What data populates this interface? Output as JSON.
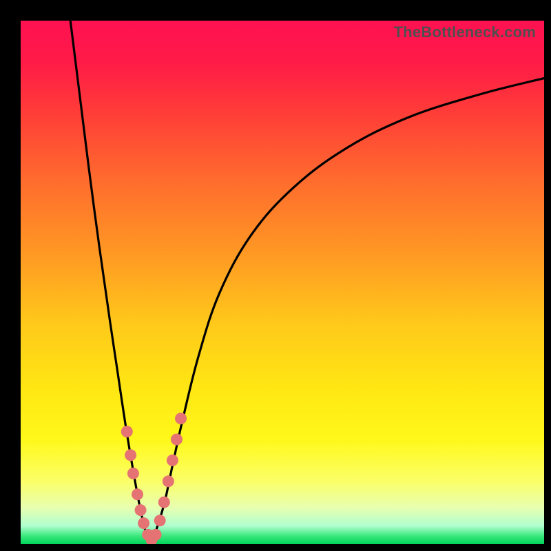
{
  "watermark": "TheBottleneck.com",
  "gradient": {
    "stops": [
      {
        "offset": 0.0,
        "color": "#ff1151"
      },
      {
        "offset": 0.08,
        "color": "#ff1b47"
      },
      {
        "offset": 0.18,
        "color": "#ff3e37"
      },
      {
        "offset": 0.3,
        "color": "#ff6a2e"
      },
      {
        "offset": 0.45,
        "color": "#ff9a23"
      },
      {
        "offset": 0.58,
        "color": "#ffc91a"
      },
      {
        "offset": 0.7,
        "color": "#ffe613"
      },
      {
        "offset": 0.8,
        "color": "#fff81a"
      },
      {
        "offset": 0.88,
        "color": "#fbff68"
      },
      {
        "offset": 0.93,
        "color": "#e8ffb0"
      },
      {
        "offset": 0.965,
        "color": "#b0ffd0"
      },
      {
        "offset": 0.985,
        "color": "#38e77a"
      },
      {
        "offset": 1.0,
        "color": "#00d35a"
      }
    ]
  },
  "chart_data": {
    "type": "line",
    "title": "",
    "xlabel": "",
    "ylabel": "",
    "xlim": [
      0,
      100
    ],
    "ylim": [
      0,
      100
    ],
    "series": [
      {
        "name": "left-branch",
        "x": [
          9.5,
          11,
          13,
          15,
          17,
          18.5,
          20,
          21.5,
          22.8,
          24,
          25
        ],
        "y": [
          100,
          88,
          72,
          57,
          43,
          33,
          23,
          14,
          7,
          2,
          0
        ]
      },
      {
        "name": "right-branch",
        "x": [
          25,
          26,
          27.5,
          29,
          31,
          34,
          38,
          44,
          52,
          62,
          74,
          88,
          100
        ],
        "y": [
          0,
          3,
          8,
          15,
          24,
          36,
          48,
          59,
          68,
          75.5,
          81.5,
          86,
          89
        ]
      }
    ],
    "markers": {
      "name": "salmon-dots",
      "color": "#e57373",
      "points": [
        {
          "x": 20.3,
          "y": 21.5
        },
        {
          "x": 21.0,
          "y": 17.0
        },
        {
          "x": 21.5,
          "y": 13.5
        },
        {
          "x": 22.3,
          "y": 9.5
        },
        {
          "x": 22.9,
          "y": 6.5
        },
        {
          "x": 23.5,
          "y": 4.0
        },
        {
          "x": 24.3,
          "y": 1.8
        },
        {
          "x": 25.0,
          "y": 0.8
        },
        {
          "x": 25.8,
          "y": 1.8
        },
        {
          "x": 26.6,
          "y": 4.5
        },
        {
          "x": 27.4,
          "y": 8.0
        },
        {
          "x": 28.2,
          "y": 12.0
        },
        {
          "x": 29.0,
          "y": 16.0
        },
        {
          "x": 29.8,
          "y": 20.0
        },
        {
          "x": 30.6,
          "y": 24.0
        }
      ]
    }
  }
}
